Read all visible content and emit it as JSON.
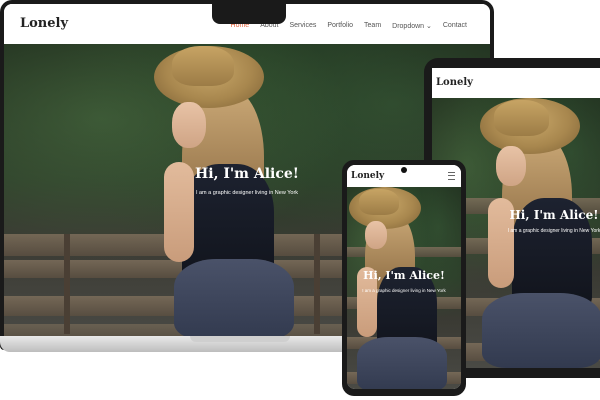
{
  "site": {
    "logo": "Lonely",
    "hero_title": "Hi, I'm Alice!",
    "hero_subtitle": "I am a graphic designer living in New York"
  },
  "nav": {
    "items": [
      {
        "label": "Home",
        "active": true
      },
      {
        "label": "About",
        "active": false
      },
      {
        "label": "Services",
        "active": false
      },
      {
        "label": "Portfolio",
        "active": false
      },
      {
        "label": "Team",
        "active": false
      },
      {
        "label": "Dropdown ⌄",
        "active": false
      },
      {
        "label": "Contact",
        "active": false
      }
    ]
  },
  "colors": {
    "accent": "#e0603a",
    "device_frame": "#1a1a1a",
    "nav_text": "#555555"
  },
  "icons": {
    "phone_menu": "hamburger-menu-icon"
  }
}
